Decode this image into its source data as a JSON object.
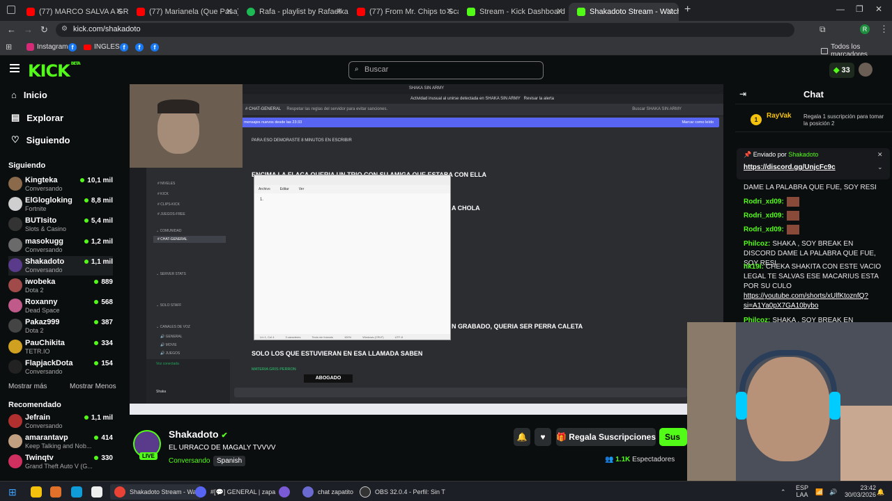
{
  "tabs": [
    {
      "label": "(77) MARCO SALVA A GRACE D",
      "color": "#ff0000"
    },
    {
      "label": "(77) Marianela (Que Pasa) (Exte",
      "color": "#ff0000"
    },
    {
      "label": "Rafa - playlist by RafaelxarecI",
      "color": "#1db954"
    },
    {
      "label": "(77) From Mr. Chips to Scarface",
      "color": "#ff0000"
    },
    {
      "label": "Stream - Kick Dashboard",
      "color": "#53fc18"
    },
    {
      "label": "Shakadoto Stream - Watch",
      "color": "#53fc18"
    }
  ],
  "address": "kick.com/shakadoto",
  "bookmarks": {
    "instagram": "Instagram",
    "ingles": "INGLES",
    "all": "Todos los marcadores"
  },
  "header": {
    "logo": "KICK",
    "beta": "BETA",
    "search_placeholder": "Buscar",
    "kicks": "33"
  },
  "nav": {
    "home": "Inicio",
    "explore": "Explorar",
    "following": "Siguiendo"
  },
  "following_title": "Siguiendo",
  "following": [
    {
      "name": "Kingteka",
      "cat": "Conversando",
      "viewers": "10,1 mil",
      "color": "#8a6a4a"
    },
    {
      "name": "ElGlogloking",
      "cat": "Fortnite",
      "viewers": "8,8 mil",
      "color": "#cfcfcf"
    },
    {
      "name": "BUTIsito",
      "cat": "Slots & Casino",
      "viewers": "5,4 mil",
      "color": "#333"
    },
    {
      "name": "masokugg",
      "cat": "Conversando",
      "viewers": "1,2 mil",
      "color": "#6a6a6a"
    },
    {
      "name": "Shakadoto",
      "cat": "Conversando",
      "viewers": "1,1 mil",
      "color": "#5a3a8a"
    },
    {
      "name": "iwobeka",
      "cat": "Dota 2",
      "viewers": "889",
      "color": "#a04a4a"
    },
    {
      "name": "Roxanny",
      "cat": "Dead Space",
      "viewers": "568",
      "color": "#c05a8a"
    },
    {
      "name": "Pakaz999",
      "cat": "Dota 2",
      "viewers": "387",
      "color": "#444"
    },
    {
      "name": "PauChikita",
      "cat": "TETR.IO",
      "viewers": "334",
      "color": "#d0a020"
    },
    {
      "name": "FlapjackDota",
      "cat": "Conversando",
      "viewers": "154",
      "color": "#222"
    }
  ],
  "show_more": "Mostrar más",
  "show_less": "Mostrar Menos",
  "recommended_title": "Recomendado",
  "recommended": [
    {
      "name": "Jefrain",
      "cat": "Conversando",
      "viewers": "1,1 mil",
      "color": "#b03030"
    },
    {
      "name": "amarantavp",
      "cat": "Keep Talking and Nob...",
      "viewers": "414",
      "color": "#c0a080"
    },
    {
      "name": "Twinqtv",
      "cat": "Grand Theft Auto V (G...",
      "viewers": "330",
      "color": "#d03060"
    }
  ],
  "video": {
    "server_title": "SHAKA SIN ARMY",
    "alert": "Actividad inusual al unirse detectada en SHAKA SIN ARMY",
    "alert_link": "Revisar la alerta",
    "channel": "CHAT-GENERAL",
    "rules": "Respetar las reglas del servidor para evitar sanciones.",
    "search": "Buscar SHAKA SIN ARMY",
    "new_messages": "mensajes nuevos desde las 23:33",
    "mark_read": "Marcar como leído",
    "msg1": "PARA ESO DEMORASTE 8 MINUTOS EN ESCRIBIR",
    "msg2": "ENCIMA LA FLACA QUERIA UN TRIO CON SU AMIGA QUE ESTABA CON ELLA",
    "msg3": "A CHOLA",
    "msg4": "N GRABADO, QUERIA SER PERRA CALETA",
    "msg5": "SOLO LOS QUE ESTUVIERAN EN ESA LLAMADA SABEN",
    "author": "MATERIA GRIS PERRON",
    "sticker": "ABOGADO",
    "voice": "Voz conectada",
    "user": "Shaka",
    "channels": [
      "NIVELES",
      "KICK",
      "CLIPS-KICK",
      "JUEGOS-FREE",
      "CHAT-GENERAL"
    ],
    "cat_community": "COMUNIDAD",
    "cat_server": "SERVER STATS",
    "cat_staff": "SOLO STAFF",
    "cat_voice": "CANALES DE VOZ",
    "voice_channels": [
      "GENERAL",
      "MOVIE",
      "JUEGOS"
    ],
    "notepad_menu": [
      "Archivo",
      "Editar",
      "Ver"
    ],
    "notepad_status": [
      "Lín 1, Col 4",
      "3 caracteres",
      "Texto sin formato",
      "100%",
      "Windows (CRLF)",
      "UTF-8"
    ],
    "notepad_text": "1."
  },
  "chat": {
    "title": "Chat",
    "pinned_user": "RayVak",
    "pinned_text": "Regala 1 suscripción para tomar la posición 2",
    "sent_by": "Enviado por",
    "sender": "Shakadoto",
    "pinned_link": "https://discord.gg/UnjcFc9c",
    "messages": [
      {
        "user": "",
        "text": "DAME LA PALABRA QUE FUE, SOY RESI"
      },
      {
        "user": "Rodri_xd09:",
        "text": ""
      },
      {
        "user": "Rodri_xd09:",
        "text": ""
      },
      {
        "user": "Rodri_xd09:",
        "text": ""
      },
      {
        "user": "Philcoz:",
        "text": "SHAKA , SOY BREAK EN DISCORD DAME LA PALABRA QUE FUE, SOY RESI"
      },
      {
        "user": "hk19i:",
        "text": "CHEKA SHAKITA CON ESTE VACIO LEGAL TE SALVAS ESE MACARIUS ESTA POR SU CULO"
      },
      {
        "user": "",
        "text": "https://youtube.com/shorts/xUlfKtoznfQ?si=A1Ya0pX7GA10bybo"
      },
      {
        "user": "Philcoz:",
        "text": "SHAKA , SOY BREAK EN DISCORD"
      }
    ]
  },
  "channel": {
    "name": "Shakadoto",
    "live": "LIVE",
    "title": "EL URRACO DE MAGALY TVVVV",
    "category": "Conversando",
    "language": "Spanish",
    "gift_button": "Regala Suscripciones",
    "sub_button": "Sus",
    "viewers": "1.1K",
    "viewers_label": "Espectadores"
  },
  "taskbar": {
    "chrome_label": "Shakadoto Stream - Wa",
    "discord_label": "#[💬] GENERAL | zapa",
    "chat_label": "chat zapatito",
    "obs_label": "OBS 32.0.4 - Perfil: Sin T",
    "lang1": "ESP",
    "lang2": "LAA",
    "time": "23:42",
    "date": "30/03/2026"
  }
}
